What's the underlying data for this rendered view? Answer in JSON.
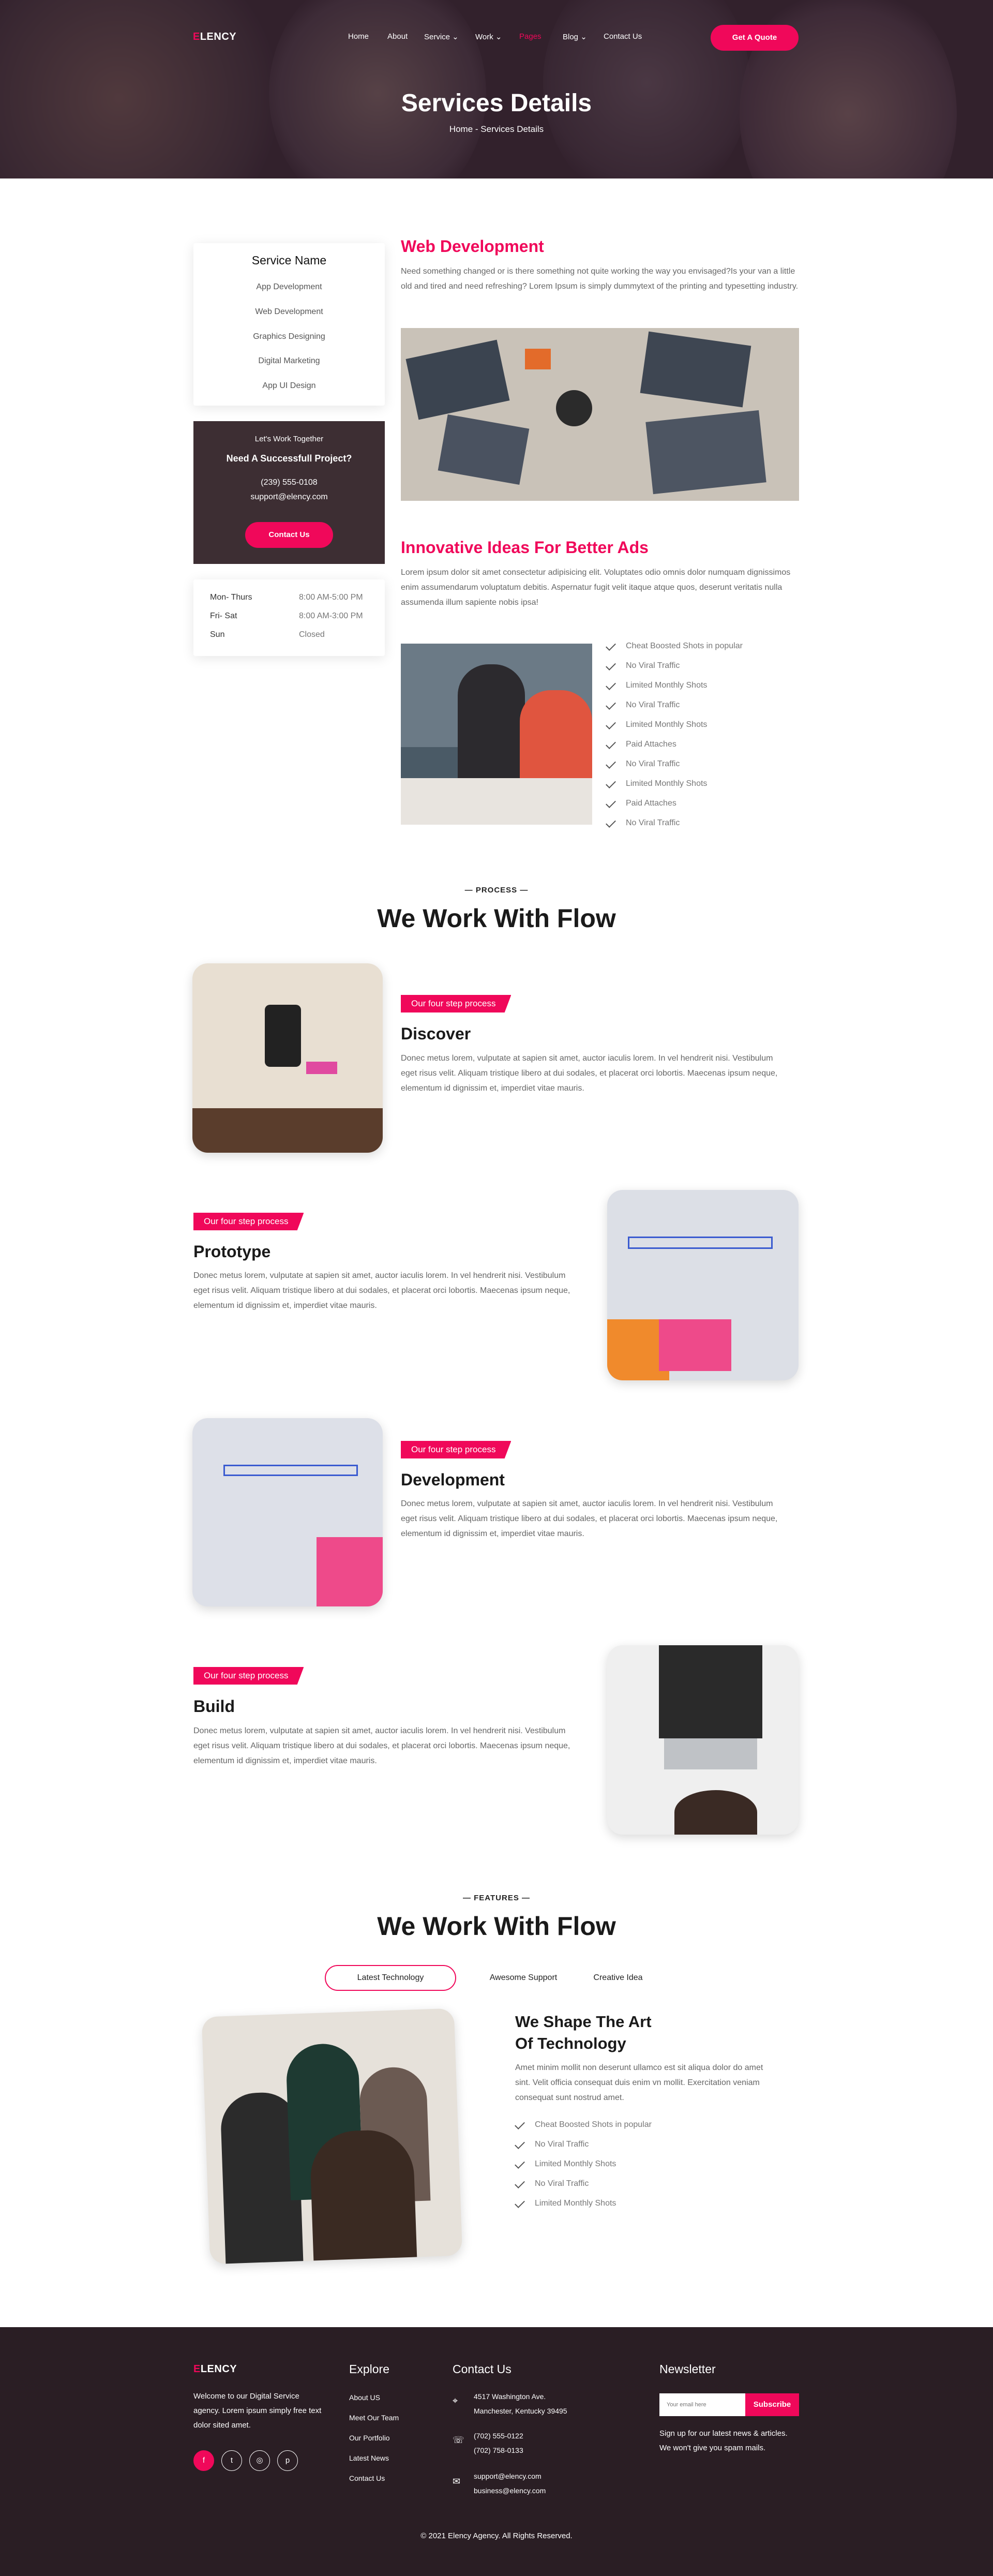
{
  "brand": {
    "logo_e": "E",
    "logo_rest": "LENCY"
  },
  "nav": {
    "items": [
      "Home",
      "About",
      "Service ⌄",
      "Work ⌄",
      "Pages",
      "Blog ⌄",
      "Contact Us"
    ],
    "quote_button": "Get A Quote"
  },
  "hero": {
    "title": "Services Details",
    "breadcrumb": "Home - Services Details"
  },
  "sidebar": {
    "service_title": "Service Name",
    "services": [
      "App Development",
      "Web Development",
      "Graphics Designing",
      "Digital Marketing",
      "App UI Design"
    ],
    "cta": {
      "kicker": "Let's Work Together",
      "title": "Need A Successfull Project?",
      "phone": "(239) 555-0108",
      "email": "support@elency.com",
      "button": "Contact Us"
    },
    "hours": [
      {
        "day": "Mon- Thurs",
        "time": "8:00 AM-5:00 PM"
      },
      {
        "day": "Fri- Sat",
        "time": "8:00 AM-3:00 PM"
      },
      {
        "day": "Sun",
        "time": "Closed"
      }
    ]
  },
  "main": {
    "title": "Web Development",
    "intro": "Need something changed or is there something not quite working the way you envisaged?Is your van a little old and tired and need refreshing? Lorem Ipsum is simply dummytext of the printing and typesetting industry.",
    "ideas_title": "Innovative Ideas For Better Ads",
    "ideas_text": "Lorem ipsum dolor sit amet consectetur adipisicing elit. Voluptates odio omnis dolor numquam dignissimos enim assumendarum voluptatum debitis. Aspernatur fugit velit itaque atque quos, deserunt veritatis nulla assumenda illum sapiente nobis ipsa!",
    "checklist": [
      "Cheat Boosted Shots in popular",
      "No Viral Traffic",
      "Limited Monthly Shots",
      "No Viral Traffic",
      "Limited Monthly Shots",
      "Paid Attaches",
      "No Viral Traffic",
      "Limited Monthly Shots",
      "Paid Attaches",
      "No Viral Traffic"
    ]
  },
  "process": {
    "kicker": "— PROCESS —",
    "title": "We Work With Flow",
    "tag": "Our four step process",
    "text": "Donec metus lorem, vulputate at sapien sit amet, auctor iaculis lorem. In vel hendrerit nisi. Vestibulum eget risus velit. Aliquam tristique libero at dui sodales, et placerat orci lobortis. Maecenas ipsum neque, elementum id dignissim et, imperdiet vitae mauris.",
    "steps": [
      "Discover",
      "Prototype",
      "Development",
      "Build"
    ]
  },
  "features": {
    "kicker": "— FEATURES —",
    "title": "We Work With Flow",
    "tabs": [
      "Latest Technology",
      "Awesome Support",
      "Creative Idea"
    ],
    "heading_1": "We Shape The Art",
    "heading_2": "Of Technology",
    "text": "Amet minim mollit non deserunt ullamco est sit aliqua dolor do amet sint. Velit officia consequat duis enim vn mollit. Exercitation veniam consequat sunt nostrud amet.",
    "checklist": [
      "Cheat Boosted Shots in popular",
      "No Viral Traffic",
      "Limited Monthly Shots",
      "No Viral Traffic",
      "Limited Monthly Shots"
    ]
  },
  "footer": {
    "about": "Welcome to our Digital Service agency. Lorem ipsum simply free text dolor sited amet.",
    "socials": [
      "f",
      "t",
      "◎",
      "p"
    ],
    "explore_title": "Explore",
    "explore": [
      "About US",
      "Meet Our Team",
      "Our Portfolio",
      "Latest News",
      "Contact Us"
    ],
    "contact_title": "Contact Us",
    "address_1": "4517 Washington Ave.",
    "address_2": "Manchester, Kentucky 39495",
    "phone_1": "(702) 555-0122",
    "phone_2": "(702) 758-0133",
    "email_1": "support@elency.com",
    "email_2": "business@elency.com",
    "newsletter_title": "Newsletter",
    "email_placeholder": "Your email here",
    "subscribe": "Subscribe",
    "newsletter_text": "Sign up for our latest news & articles. We won't give you spam mails.",
    "copyright": "© 2021 Elency Agency. All Rights Reserved."
  },
  "colors": {
    "accent": "#f0085a",
    "dark": "#2a1e24",
    "sidebar_card": "#3d2e33"
  }
}
